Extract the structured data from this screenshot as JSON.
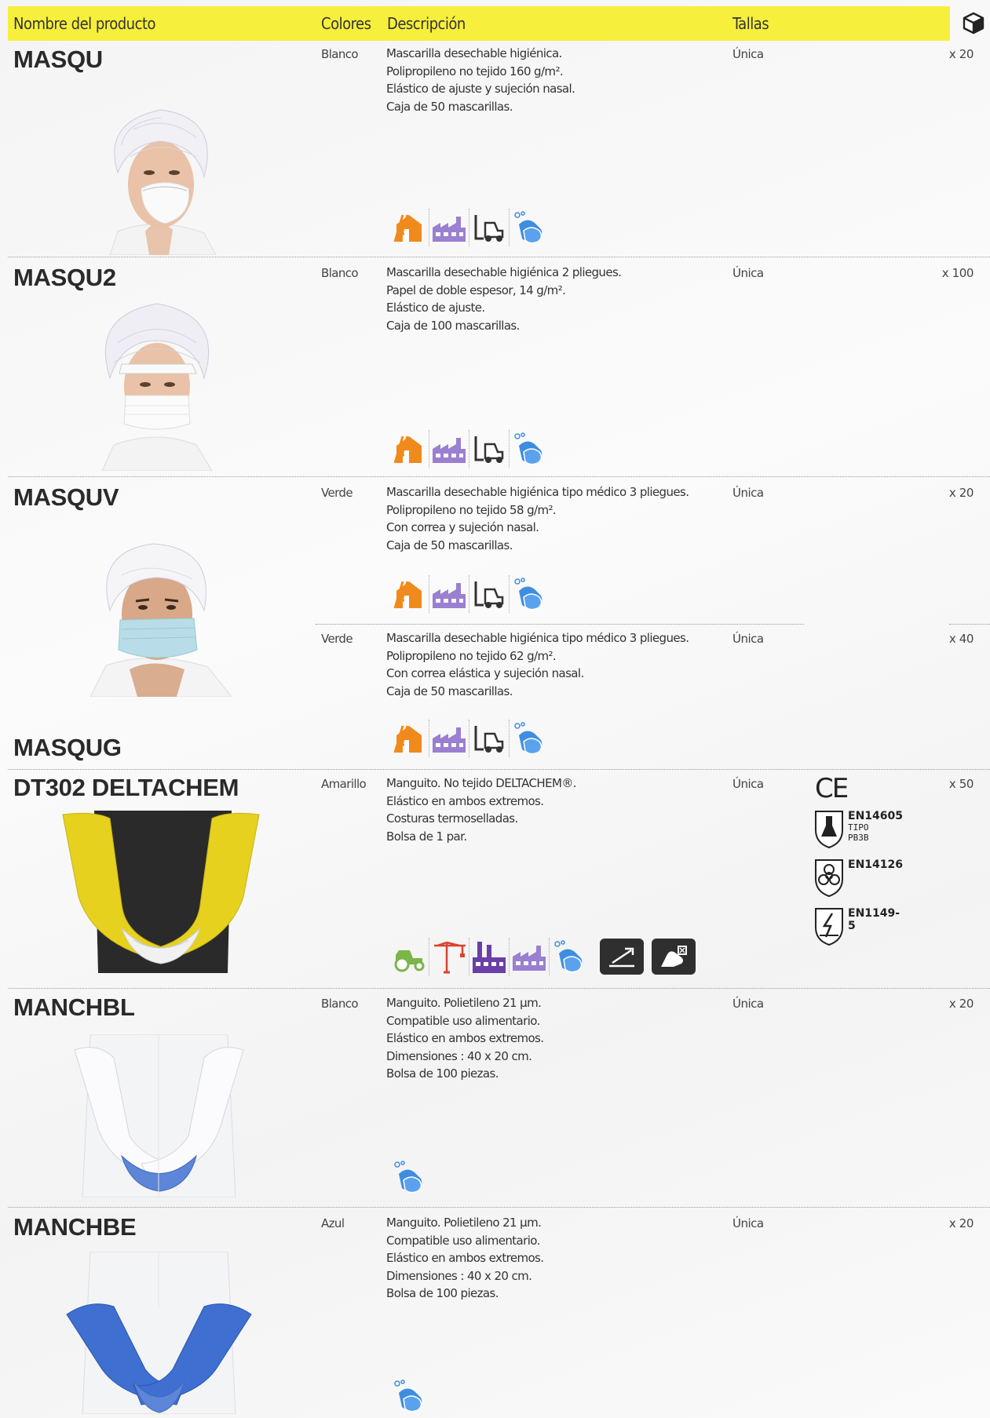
{
  "header": {
    "col_name": "Nombre del producto",
    "col_colors": "Colores",
    "col_desc": "Descripción",
    "col_sizes": "Tallas",
    "box_icon": "box-icon"
  },
  "products": [
    {
      "name": "MASQU",
      "color": "Blanco",
      "desc": [
        "Mascarilla desechable higiénica.",
        "Polipropileno no tejido 160 g/m².",
        "Elástico de ajuste y sujeción nasal.",
        "Caja de 50 mascarillas."
      ],
      "size": "Única",
      "qty": "x 20"
    },
    {
      "name": "MASQU2",
      "color": "Blanco",
      "desc": [
        "Mascarilla desechable higiénica 2 pliegues.",
        "Papel de doble espesor, 14 g/m².",
        "Elástico de ajuste.",
        "Caja de 100 mascarillas."
      ],
      "size": "Única",
      "qty": "x 100"
    },
    {
      "name": "MASQUV",
      "color": "Verde",
      "desc": [
        "Mascarilla desechable higiénica tipo médico 3 pliegues.",
        "Polipropileno no tejido 58 g/m².",
        "Con correa y sujeción nasal.",
        "Caja de 50 mascarillas."
      ],
      "size": "Única",
      "qty": "x 20"
    },
    {
      "name": "MASQUG",
      "color": "Verde",
      "desc": [
        "Mascarilla desechable higiénica tipo médico 3 pliegues.",
        "Polipropileno no tejido 62 g/m².",
        "Con correa elástica y sujeción nasal.",
        "Caja de 50 mascarillas."
      ],
      "size": "Única",
      "qty": "x 40"
    },
    {
      "name": "DT302 DELTACHEM",
      "color": "Amarillo",
      "desc": [
        "Manguito. No tejido DELTACHEM®.",
        "Elástico en ambos extremos.",
        "Costuras termoselladas.",
        "Bolsa de 1 par."
      ],
      "size": "Única",
      "qty": "x 50",
      "ce": "CE",
      "norms": [
        {
          "code": "EN14605",
          "sub": "TIPO PB3B"
        },
        {
          "code": "EN14126",
          "sub": ""
        },
        {
          "code": "EN1149-5",
          "sub": ""
        }
      ]
    },
    {
      "name": "MANCHBL",
      "color": "Blanco",
      "desc": [
        "Manguito. Polietileno 21 µm.",
        "Compatible uso alimentario.",
        "Elástico en ambos extremos.",
        "Dimensiones : 40 x 20 cm.",
        "Bolsa de 100 piezas."
      ],
      "size": "Única",
      "qty": "x 20"
    },
    {
      "name": "MANCHBE",
      "color": "Azul",
      "desc": [
        "Manguito. Polietileno 21 µm.",
        "Compatible uso alimentario.",
        "Elástico en ambos extremos.",
        "Dimensiones : 40 x 20 cm.",
        "Bolsa de 100 piezas."
      ],
      "size": "Única",
      "qty": "x 20"
    }
  ],
  "icon_names": {
    "construction": "construction-icon",
    "industry": "industry-icon",
    "logistics": "forklift-icon",
    "hygiene": "hands-washing-icon",
    "agriculture": "tractor-icon",
    "crane": "crane-icon",
    "chemical_plant": "chemical-plant-icon",
    "tear": "tear-pictogram-icon",
    "hand_cut": "hand-protection-pictogram-icon"
  },
  "colors": {
    "header_bg": "#f6ef3c",
    "construction": "#f08a1c",
    "industry": "#9b7fd0",
    "logistics": "#333333",
    "hygiene": "#3f8de0",
    "agriculture": "#7ab648",
    "crane": "#d8432e",
    "chemical_plant": "#6a3fa8"
  }
}
